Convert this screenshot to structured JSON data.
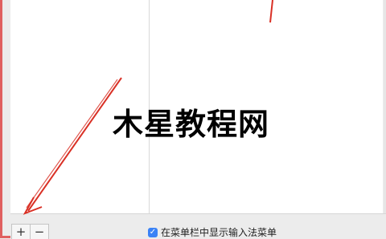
{
  "footer": {
    "add_label": "+",
    "remove_label": "−",
    "show_menu_checkbox": {
      "checked": true,
      "label": "在菜单栏中显示输入法菜单"
    }
  },
  "overlay": {
    "watermark_text": "木星教程网",
    "annotation_color": "#d93025"
  }
}
